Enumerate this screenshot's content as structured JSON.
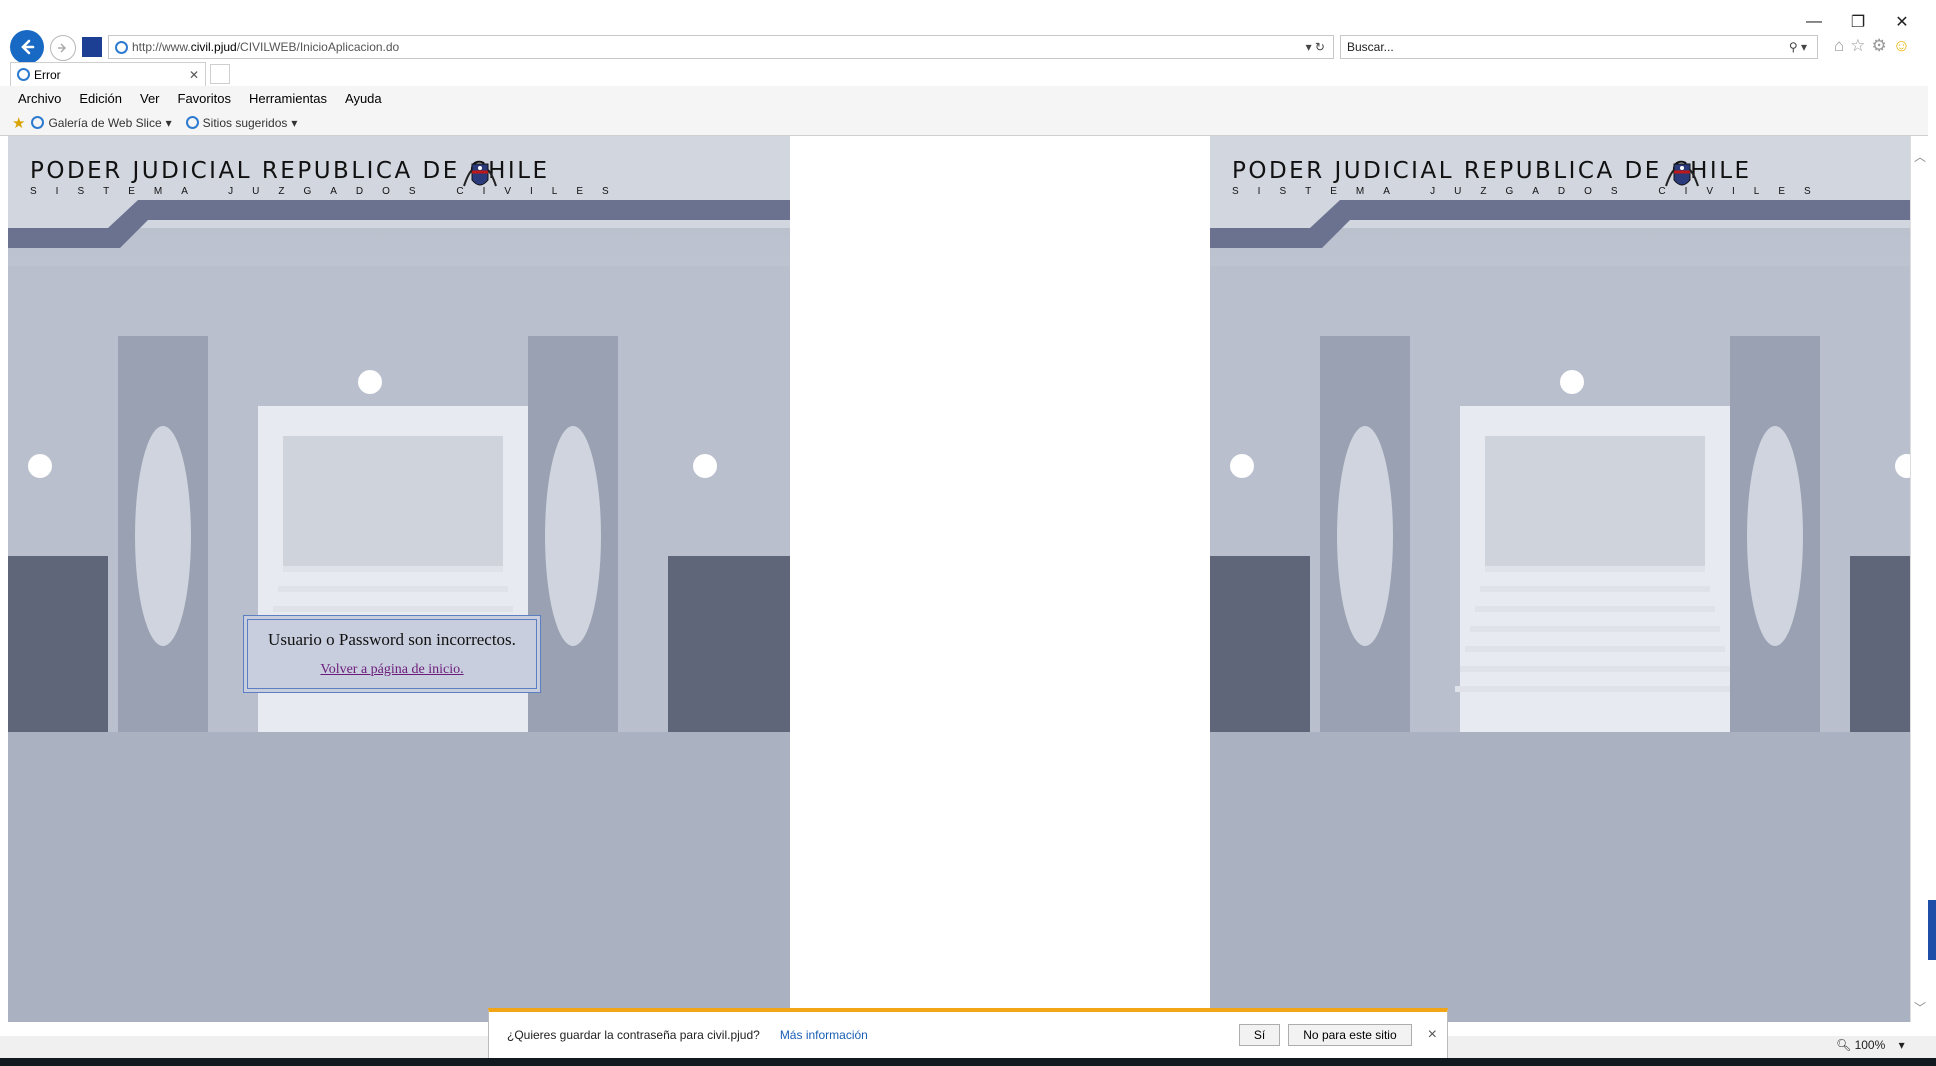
{
  "browser": {
    "url_prefix": "http://www.",
    "url_host": "civil.pjud",
    "url_path": "/CIVILWEB/InicioAplicacion.do",
    "search_placeholder": "Buscar...",
    "tab_title": "Error",
    "menu": [
      "Archivo",
      "Edición",
      "Ver",
      "Favoritos",
      "Herramientas",
      "Ayuda"
    ],
    "favorites": {
      "web_slice": "Galería de Web Slice",
      "suggested": "Sitios sugeridos"
    },
    "window_controls": {
      "minimize": "—",
      "restore": "❐",
      "close": "✕"
    },
    "accent_color": "#1769c4"
  },
  "page": {
    "banner_title": "PODER JUDICIAL REPUBLICA DE CHILE",
    "banner_subtitle": "SISTEMA JUZGADOS CIVILES",
    "error_message": "Usuario o Password son incorrectos.",
    "back_link": "Volver a página de inicio."
  },
  "notification": {
    "question": "¿Quieres guardar la contraseña para civil.pjud?",
    "more_info": "Más información",
    "yes": "Sí",
    "not_for_site": "No para este sitio",
    "close": "×"
  },
  "status": {
    "zoom": "100%"
  }
}
